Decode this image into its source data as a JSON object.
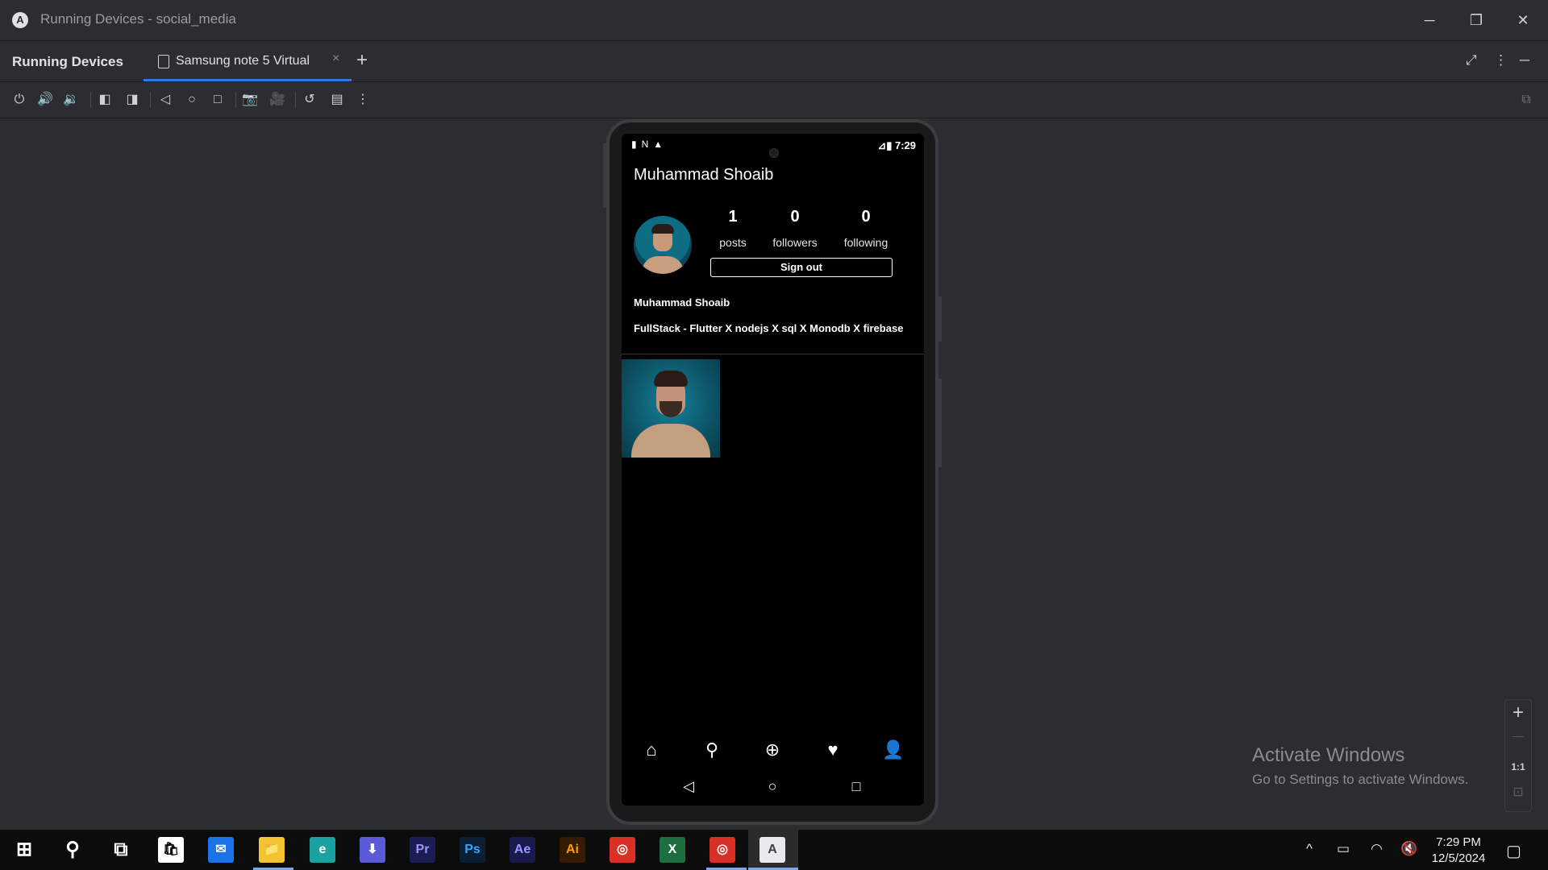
{
  "window": {
    "title": "Running Devices - social_media",
    "logo_glyph": "A",
    "minimize_icon": "─",
    "restore_icon": "❐",
    "close_icon": "✕"
  },
  "tool_window": {
    "title": "Running Devices",
    "tab_label": "Samsung note 5 Virtual",
    "tab_close": "×",
    "add_tab": "+",
    "right_icons": [
      "⤢",
      "⋮",
      "─"
    ]
  },
  "toolbar": {
    "icons": [
      "power-icon",
      "volume-up-icon",
      "volume-down-icon",
      "rotate-left-icon",
      "rotate-right-icon",
      "back-icon",
      "home-icon",
      "overview-icon",
      "screenshot-icon",
      "screen-record-icon",
      "reset-icon",
      "display-mode-icon",
      "more-icon"
    ],
    "glyphs": [
      "⏻",
      "🔊",
      "🔉",
      "◧",
      "◨",
      "◁",
      "○",
      "□",
      "📷",
      "🎥",
      "↺",
      "▤",
      "⋮"
    ],
    "right_glyph": "⧉"
  },
  "device": {
    "status_bar": {
      "left_icons": "▮N▲",
      "right_text": "⊿▮ 7:29"
    },
    "profile": {
      "username": "Muhammad Shoaib",
      "posts_count": "1",
      "posts_label": "posts",
      "followers_count": "0",
      "followers_label": "followers",
      "following_count": "0",
      "following_label": "following",
      "sign_out_label": "Sign out",
      "display_name": "Muhammad Shoaib",
      "bio": "FullStack - Flutter X nodejs X sql X Monodb X firebase"
    },
    "bottom_nav": {
      "icons": [
        "home-icon",
        "search-icon",
        "add-post-icon",
        "heart-icon",
        "profile-icon"
      ],
      "glyphs": [
        "⌂",
        "⚲",
        "⊕",
        "♥",
        "👤"
      ]
    },
    "system_nav": {
      "back": "◁",
      "home": "○",
      "recents": "□"
    }
  },
  "zoom": {
    "zoom_in": "+",
    "zoom_out": "—",
    "actual_size": "1:1",
    "fit": "⊡"
  },
  "watermark": {
    "title": "Activate Windows",
    "subtitle": "Go to Settings to activate Windows."
  },
  "taskbar": {
    "apps": [
      {
        "name": "start",
        "glyph": "⊞",
        "bg": "transparent",
        "fg": "#ffffff"
      },
      {
        "name": "search",
        "glyph": "⚲",
        "bg": "transparent",
        "fg": "#ffffff"
      },
      {
        "name": "task-view",
        "glyph": "⧉",
        "bg": "transparent",
        "fg": "#ffffff"
      },
      {
        "name": "store",
        "glyph": "🛍",
        "bg": "#ffffff",
        "fg": "#000000"
      },
      {
        "name": "mail",
        "glyph": "✉",
        "bg": "#1a73e8",
        "fg": "#ffffff"
      },
      {
        "name": "file-explorer",
        "glyph": "📁",
        "bg": "#f4c430",
        "fg": "#000000"
      },
      {
        "name": "edge",
        "glyph": "e",
        "bg": "#1ba1a0",
        "fg": "#ffffff"
      },
      {
        "name": "installer",
        "glyph": "⬇",
        "bg": "#5a5ad6",
        "fg": "#ffffff"
      },
      {
        "name": "premiere",
        "glyph": "Pr",
        "bg": "#1d1d56",
        "fg": "#9999ff"
      },
      {
        "name": "photoshop",
        "glyph": "Ps",
        "bg": "#0a1f33",
        "fg": "#31a8ff"
      },
      {
        "name": "after-effects",
        "glyph": "Ae",
        "bg": "#1a1a4d",
        "fg": "#9999ff"
      },
      {
        "name": "illustrator",
        "glyph": "Ai",
        "bg": "#331c00",
        "fg": "#ff9a00"
      },
      {
        "name": "chrome",
        "glyph": "◎",
        "bg": "#d93025",
        "fg": "#ffffff"
      },
      {
        "name": "excel",
        "glyph": "X",
        "bg": "#1d6f42",
        "fg": "#ffffff"
      },
      {
        "name": "chrome-profile",
        "glyph": "◎",
        "bg": "#d93025",
        "fg": "#ffffff"
      },
      {
        "name": "android-studio",
        "glyph": "A",
        "bg": "#e8eaed",
        "fg": "#3c4043"
      }
    ],
    "tray_glyphs": [
      "^",
      "▭",
      "◠",
      "🔇"
    ],
    "time": "7:29 PM",
    "date": "12/5/2024",
    "notifications_glyph": "▢"
  }
}
